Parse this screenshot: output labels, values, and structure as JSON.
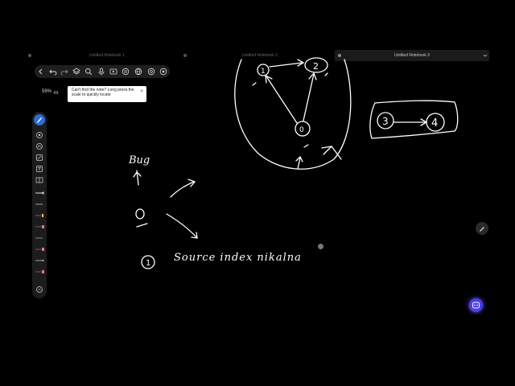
{
  "tabs": [
    {
      "label": "Untitled Notebook 1",
      "active": false
    },
    {
      "label": "Untitled Notebook 2",
      "active": false
    },
    {
      "label": "Untitled Notebook 3",
      "active": true
    }
  ],
  "toolbar": {
    "icons": [
      "back-icon",
      "undo-icon",
      "redo-icon",
      "layers-icon",
      "search-icon",
      "mic-icon",
      "play-icon",
      "globe-icon",
      "audio-icon",
      "more-icon"
    ]
  },
  "zoom": {
    "value": "59%"
  },
  "tooltip": {
    "text": "Can't find the note? Long press the scale to quickly locate",
    "close": "×"
  },
  "colors": {
    "accent": "#2e6bd9",
    "ai": "#4b3df0",
    "ink": "#ffffff",
    "pink": "#e8768a",
    "yellow": "#e6c84b"
  },
  "handwriting": {
    "node_1": "1",
    "node_2": "2",
    "node_3": "3",
    "node_4": "4",
    "node_0": "0",
    "bug_label": "Bug",
    "item_number": "1",
    "item_text": "Source index nikalna"
  }
}
